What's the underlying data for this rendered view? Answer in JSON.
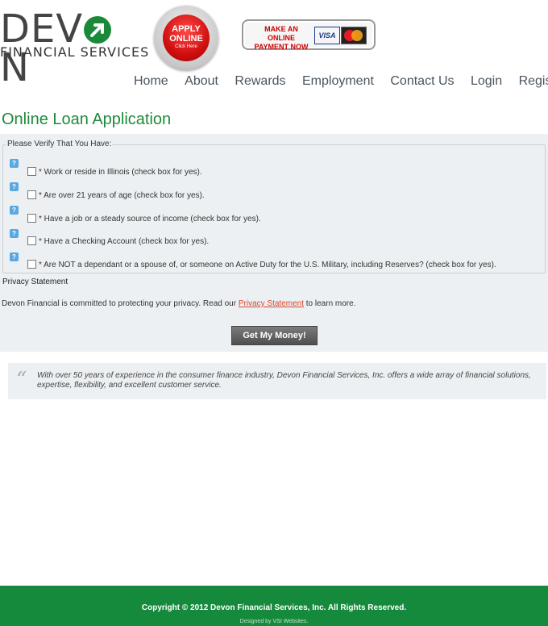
{
  "header": {
    "logo_main": "DEVON",
    "logo_sub": "FINANCIAL SERVICES",
    "apply_line1": "APPLY",
    "apply_line2": "ONLINE",
    "apply_line3": "Click Here",
    "pay_line1": "MAKE AN ONLINE",
    "pay_line2": "PAYMENT NOW",
    "visa": "VISA"
  },
  "nav": {
    "items": [
      "Home",
      "About",
      "Rewards",
      "Employment",
      "Contact Us",
      "Login",
      "Register"
    ]
  },
  "page": {
    "title": "Online Loan Application"
  },
  "form": {
    "legend": "Please Verify That You Have:",
    "checks": [
      "* Work or reside in Illinois (check box for yes).",
      "* Are over 21 years of age (check box for yes).",
      "* Have a job or a steady source of income (check box for yes).",
      "* Have a Checking Account (check box for yes).",
      "* Are NOT a dependant or a spouse of, or someone on Active Duty for the U.S. Military, including Reserves? (check box for yes)."
    ],
    "help_glyph": "?",
    "privacy_heading": "Privacy Statement",
    "privacy_before": "Devon Financial is committed to protecting your privacy. Read our ",
    "privacy_link": "Privacy Statement",
    "privacy_after": " to learn more.",
    "submit_label": "Get My Money!"
  },
  "quote": {
    "mark": "“",
    "text": "With over 50 years of experience in the consumer finance industry, Devon Financial Services, Inc. offers a wide array of financial solutions, expertise, flexibility, and excellent customer service."
  },
  "footer": {
    "copyright": "Copyright © 2012 Devon Financial Services, Inc. All Rights Reserved.",
    "designed_by": "Designed by VSI Websites."
  },
  "colors": {
    "brand_green": "#1f8a3b",
    "footer_green": "#168a3c",
    "apply_red": "#d10f0f",
    "link_red": "#d9472b"
  }
}
